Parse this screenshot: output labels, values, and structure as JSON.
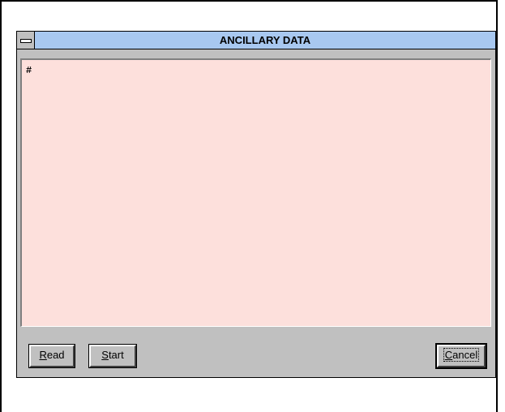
{
  "window": {
    "title": "ANCILLARY DATA"
  },
  "content": {
    "text": "#"
  },
  "buttons": {
    "read": {
      "mnemonic": "R",
      "rest": "ead"
    },
    "start": {
      "mnemonic": "S",
      "rest": "tart"
    },
    "cancel": {
      "mnemonic": "C",
      "rest": "ancel"
    }
  },
  "colors": {
    "title_bar": "#a8c8f0",
    "content_background": "#fde0dc",
    "dialog_background": "#c0c0c0"
  }
}
